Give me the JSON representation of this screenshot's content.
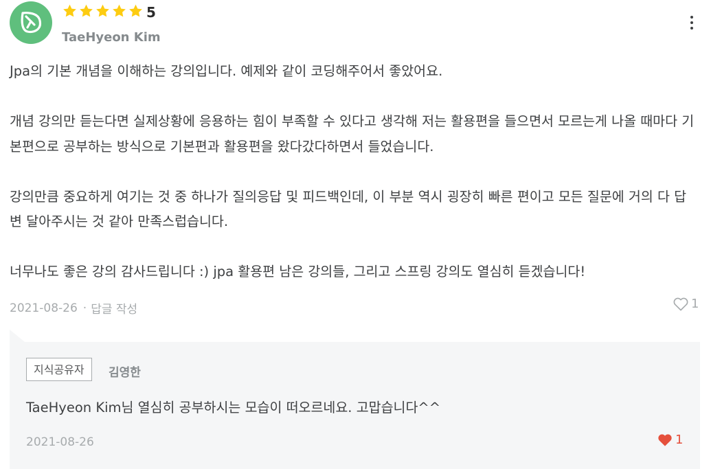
{
  "review": {
    "rating_stars": 5,
    "rating": "5",
    "author": "TaeHyeon Kim",
    "paragraphs": [
      "Jpa의 기본 개념을 이해하는 강의입니다. 예제와 같이 코딩해주어서 좋았어요.",
      "개념 강의만 듣는다면 실제상황에 응용하는 힘이 부족할 수 있다고 생각해 저는 활용편을 들으면서 모르는게 나올 때마다 기본편으로 공부하는 방식으로 기본편과 활용편을 왔다갔다하면서 들었습니다.",
      "강의만큼 중요하게 여기는 것 중 하나가 질의응답 및 피드백인데, 이 부분 역시 굉장히 빠른 편이고 모든 질문에 거의 다 답변 달아주시는 것 같아 만족스럽습니다.",
      "너무나도 좋은 강의 감사드립니다 :) jpa 활용편 남은 강의들, 그리고 스프링 강의도 열심히 듣겠습니다!"
    ],
    "date": "2021-08-26",
    "separator": "·",
    "reply_action": "답글 작성",
    "likes": "1"
  },
  "reply": {
    "badge": "지식공유자",
    "author": "김영한",
    "text": "TaeHyeon Kim님 열심히 공부하시는 모습이 떠오르네요. 고맙습니다^^",
    "date": "2021-08-26",
    "likes": "1"
  },
  "colors": {
    "star": "#fdcc11",
    "avatar": "#5fbf7d",
    "liked_heart": "#e5503c",
    "reply_bg": "#f5f6f7"
  },
  "icons": {
    "avatar": "leaf-logo-icon",
    "star": "star-icon",
    "more": "more-vertical-icon",
    "like_outline": "heart-outline-icon",
    "like_filled": "heart-filled-icon"
  }
}
